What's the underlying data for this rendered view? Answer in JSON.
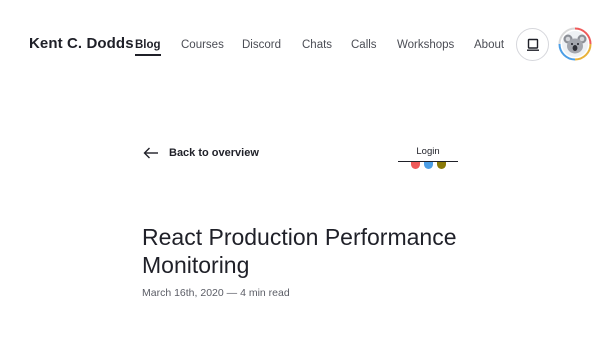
{
  "site": {
    "brand": "Kent C. Dodds"
  },
  "nav": {
    "items": [
      {
        "label": "Blog",
        "active": true
      },
      {
        "label": "Courses",
        "active": false
      },
      {
        "label": "Discord",
        "active": false
      },
      {
        "label": "Chats",
        "active": false
      },
      {
        "label": "Calls",
        "active": false
      },
      {
        "label": "Workshops",
        "active": false
      },
      {
        "label": "About",
        "active": false
      }
    ]
  },
  "header_actions": {
    "theme_icon": "laptop-icon",
    "avatar_icon": "koala-avatar-icon"
  },
  "back": {
    "label": "Back to overview",
    "icon": "arrow-left-icon"
  },
  "login": {
    "label": "Login",
    "team_colors": [
      "#ef5a5a",
      "#4b9ee6",
      "#8a7a0a"
    ]
  },
  "post": {
    "title": "React Production Performance Monitoring",
    "date": "March 16th, 2020",
    "separator": "—",
    "read_time": "4 min read"
  }
}
